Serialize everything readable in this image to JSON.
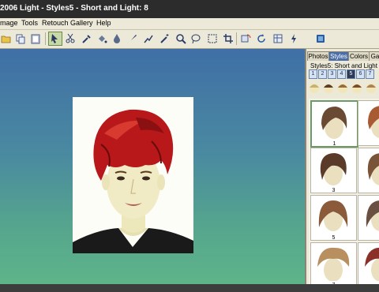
{
  "window": {
    "title": "2006 Light - Styles5 - Short and Light: 8"
  },
  "menu": {
    "items": [
      "mage",
      "Tools",
      "Retouch",
      "Gallery",
      "Help"
    ]
  },
  "toolbar": {
    "icons": [
      "open-icon",
      "copy-icon",
      "paste-icon",
      "pointer-icon",
      "scissors-icon",
      "eyedropper-icon",
      "fill-icon",
      "drop-icon",
      "brush-icon",
      "smudge-icon",
      "magic-wand-icon",
      "zoom-icon",
      "lasso-icon",
      "rectangle-select-icon",
      "crop-icon",
      "rotate-icon",
      "refresh-icon",
      "grid-icon",
      "flash-icon",
      "info-icon"
    ],
    "active": "pointer-icon"
  },
  "panel": {
    "tabs": [
      "Photos",
      "Styles",
      "Colors",
      "Ga"
    ],
    "active_tab": "Styles",
    "styles_label": "Styles5: Short and Light",
    "pages": [
      "1",
      "2",
      "3",
      "4",
      "5",
      "6",
      "7"
    ],
    "selected_page": "5",
    "thumbnails": [
      {
        "label": "1",
        "color": "#6b4a34"
      },
      {
        "label": "",
        "color": "#a85a32"
      },
      {
        "label": "3",
        "color": "#5a3a28"
      },
      {
        "label": "",
        "color": "#7a5438"
      },
      {
        "label": "5",
        "color": "#8a5a3a"
      },
      {
        "label": "",
        "color": "#6a5040"
      },
      {
        "label": "7",
        "color": "#b89060"
      },
      {
        "label": "",
        "color": "#8a3028"
      }
    ]
  },
  "colors": {
    "accent": "#4a6ea8",
    "canvas_top": "#3f6fa6",
    "canvas_bottom": "#5eb489",
    "hair": "#b81a18"
  }
}
